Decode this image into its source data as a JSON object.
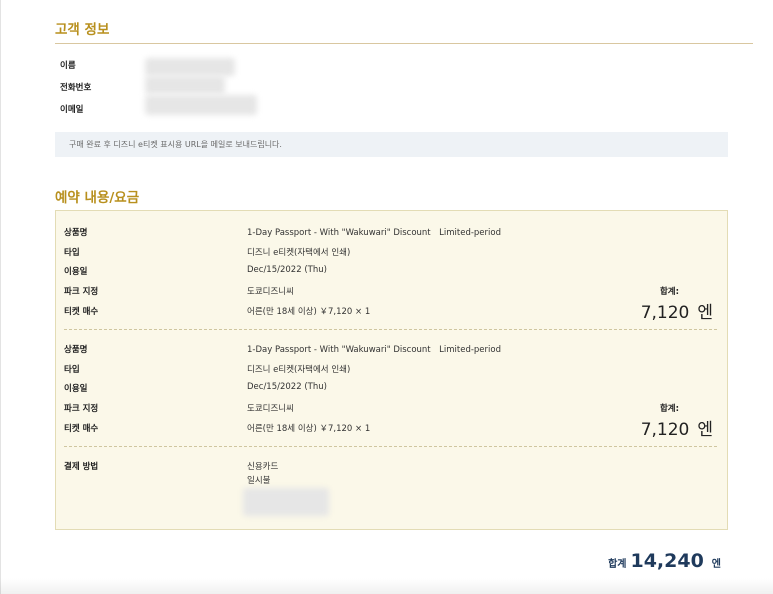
{
  "customer": {
    "title": "고객 정보",
    "name_label": "이름",
    "phone_label": "전화번호",
    "email_label": "이메일",
    "notice": "구매 완료 후 디즈니 e티켓 표시용 URL을 메일로 보내드립니다."
  },
  "booking": {
    "title": "예약 내용/요금",
    "labels": {
      "product": "상품명",
      "type": "타입",
      "date": "이용일",
      "park": "파크 지정",
      "tickets": "티켓 매수"
    },
    "items": [
      {
        "product": "1-Day Passport - With \"Wakuwari\" Discount　Limited-period",
        "type": "디즈니 e티켓(자택에서 인쇄)",
        "date": "Dec/15/2022 (Thu)",
        "park": "도쿄디즈니씨",
        "tickets": "어른(만 18세 이상) ￥7,120 × 1",
        "subtotal_label": "합계:",
        "subtotal_amount": "7,120",
        "subtotal_unit": "엔"
      },
      {
        "product": "1-Day Passport - With \"Wakuwari\" Discount　Limited-period",
        "type": "디즈니 e티켓(자택에서 인쇄)",
        "date": "Dec/15/2022 (Thu)",
        "park": "도쿄디즈니씨",
        "tickets": "어른(만 18세 이상) ￥7,120 × 1",
        "subtotal_label": "합계:",
        "subtotal_amount": "7,120",
        "subtotal_unit": "엔"
      }
    ],
    "payment": {
      "label": "결제 방법",
      "method": "신용카드",
      "installment": "일시불"
    }
  },
  "total": {
    "label": "합계",
    "amount": "14,240",
    "unit": "엔"
  },
  "colors": {
    "accent_gold": "#b8901e",
    "total_navy": "#1f3a5c",
    "booking_bg": "#fbf8e9",
    "notice_bg": "#eef2f6"
  }
}
